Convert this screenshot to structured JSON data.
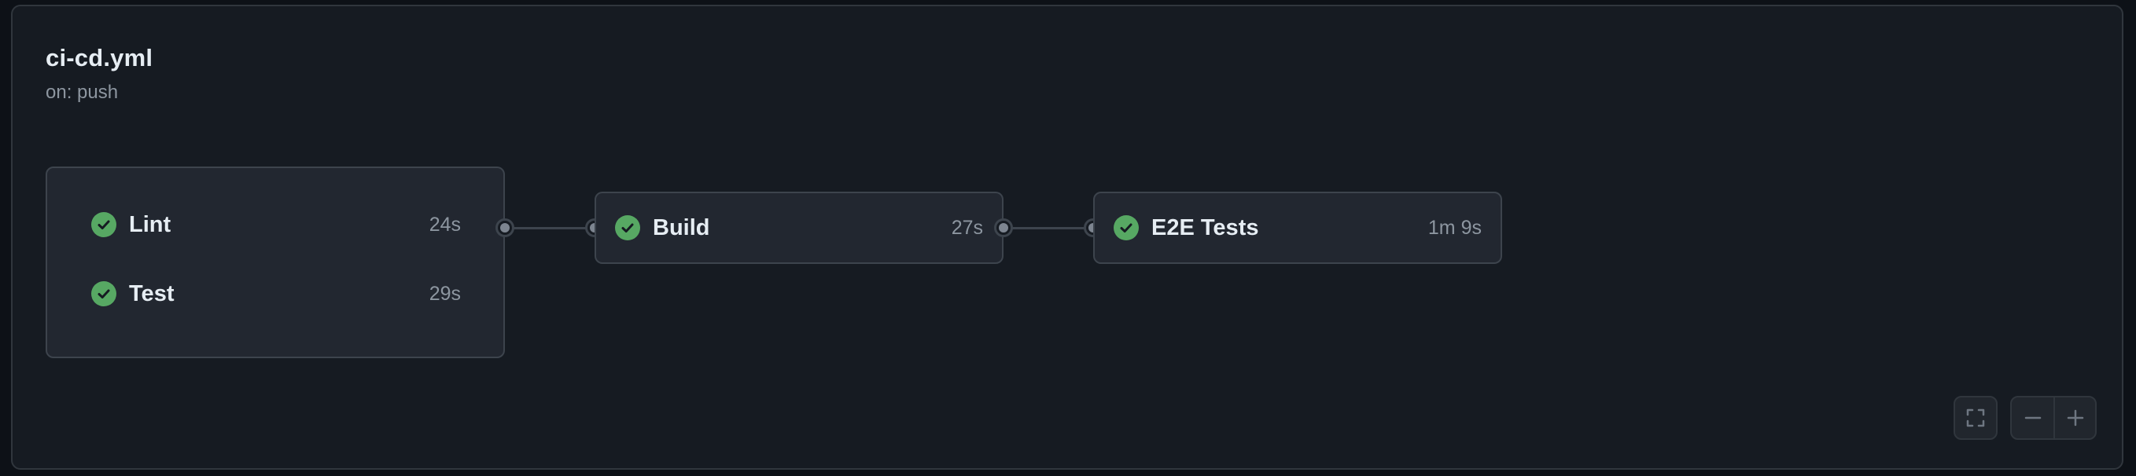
{
  "workflow": {
    "title": "ci-cd.yml",
    "trigger": "on: push"
  },
  "jobs": [
    {
      "name": "Lint",
      "duration": "24s",
      "status": "success"
    },
    {
      "name": "Test",
      "duration": "29s",
      "status": "success"
    },
    {
      "name": "Build",
      "duration": "27s",
      "status": "success"
    },
    {
      "name": "E2E Tests",
      "duration": "1m 9s",
      "status": "success"
    }
  ],
  "controls": {
    "fullscreen_icon": "fullscreen-icon",
    "zoom_out_icon": "minus-icon",
    "zoom_in_icon": "plus-icon"
  },
  "colors": {
    "success": "#57a863",
    "background": "#161b22",
    "card": "#222730",
    "border": "#3d444d"
  }
}
